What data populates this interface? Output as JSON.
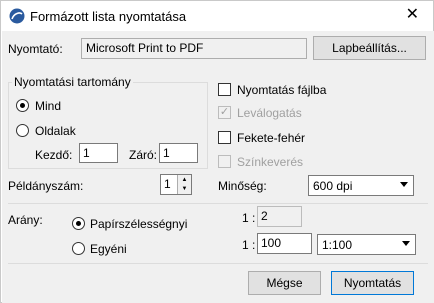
{
  "window": {
    "title": "Formázott lista nyomtatása",
    "close_glyph": "✕"
  },
  "printer": {
    "label": "Nyomtató:",
    "name": "Microsoft Print to PDF",
    "page_setup_button": "Lapbeállítás..."
  },
  "print_range": {
    "legend": "Nyomtatási tartomány",
    "all_label": "Mind",
    "pages_label": "Oldalak",
    "from_label": "Kezdő:",
    "from_value": "1",
    "to_label": "Záró:",
    "to_value": "1",
    "selected": "all"
  },
  "options": {
    "print_to_file": {
      "label": "Nyomtatás fájlba",
      "checked": false,
      "enabled": true
    },
    "collate": {
      "label": "Leválogatás",
      "checked": true,
      "enabled": false
    },
    "black_white": {
      "label": "Fekete-fehér",
      "checked": false,
      "enabled": true
    },
    "color_separation": {
      "label": "Színkeverés",
      "checked": false,
      "enabled": false
    }
  },
  "copies": {
    "label": "Példányszám:",
    "value": "1"
  },
  "quality": {
    "label": "Minőség:",
    "value": "600 dpi"
  },
  "scale": {
    "label": "Arány:",
    "fit_width_label": "Papírszélességnyi",
    "custom_label": "Egyéni",
    "selected": "fit_width",
    "ratio_prefix_1": "1 :",
    "fit_value": "2",
    "ratio_prefix_2": "1 :",
    "custom_value": "100",
    "preset_value": "1:100"
  },
  "buttons": {
    "cancel": "Mégse",
    "print": "Nyomtatás"
  },
  "icons": {
    "title": "archicad-logo-icon",
    "check": "✓"
  }
}
